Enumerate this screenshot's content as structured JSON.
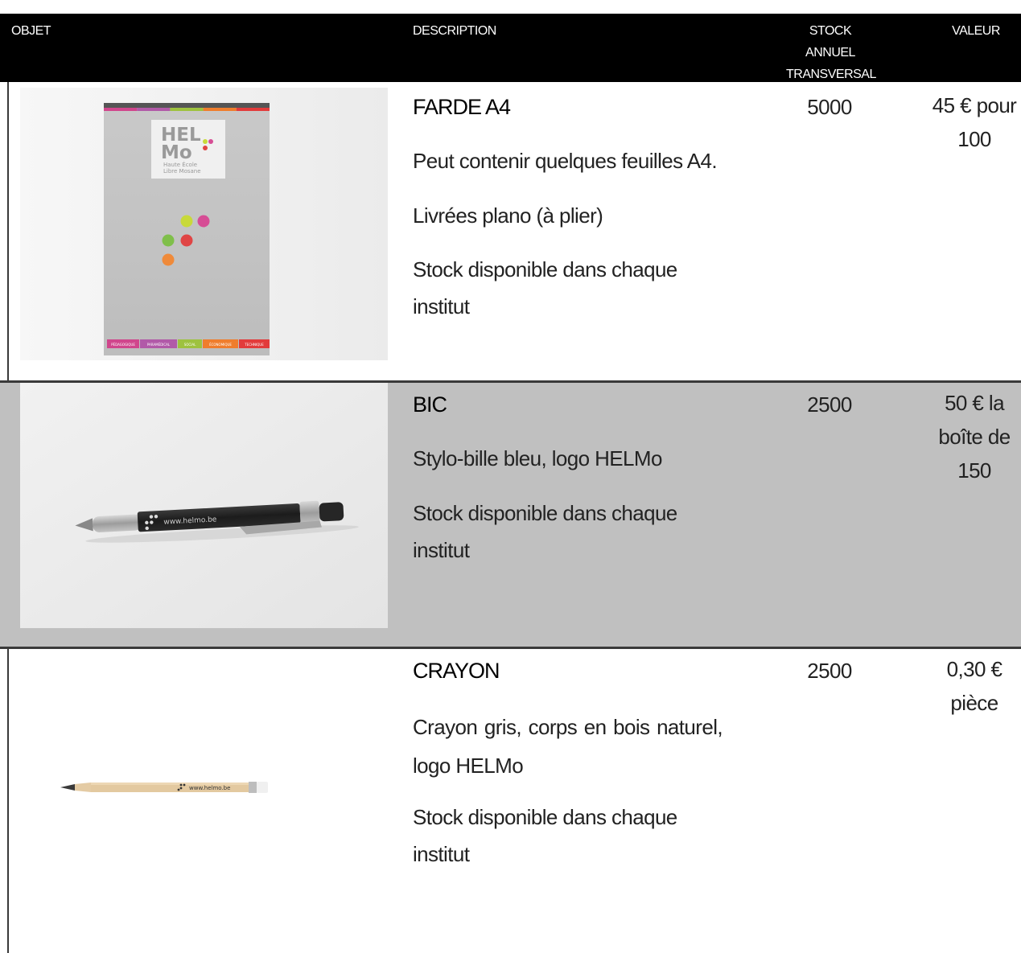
{
  "header": {
    "objet": "OBJET",
    "description": "DESCRIPTION",
    "stock_line1": "STOCK ANNUEL",
    "stock_line2": "TRANSVERSAL",
    "valeur": "VALEUR"
  },
  "rows": [
    {
      "title": "FARDE A4",
      "lines": [
        "Peut contenir quelques feuilles A4.",
        "Livrées plano (à plier)",
        "Stock disponible dans chaque institut"
      ],
      "stock": "5000",
      "value_lines": [
        "45 € pour",
        "100"
      ],
      "photo": {
        "logo_line1": "HEL",
        "logo_line2": "Mo",
        "logo_sub1": "Haute École",
        "logo_sub2": "Libre Mosane",
        "tabs": [
          "PÉDAGOGIQUE",
          "PARAMÉDICAL",
          "SOCIAL",
          "ÉCONOMIQUE",
          "TECHNIQUE"
        ],
        "tab_colors": [
          "#d0468c",
          "#b15aa8",
          "#9ec23f",
          "#ef7d2d",
          "#e23b3b"
        ],
        "dot_colors": [
          "#c8d93a",
          "#d64d95",
          "#7fbf4a",
          "#e04545",
          "#ef8a3a"
        ]
      }
    },
    {
      "title": "BIC",
      "lines": [
        "Stylo-bille bleu, logo HELMo",
        "Stock disponible dans chaque institut"
      ],
      "stock": "2500",
      "value_lines": [
        "50 € la",
        "boîte de",
        "150"
      ],
      "photo": {
        "imprint": "www.helmo.be"
      }
    },
    {
      "title": "CRAYON",
      "lines": [
        "Crayon gris, corps en bois naturel, logo HELMo",
        "Stock disponible dans chaque institut"
      ],
      "stock": "2500",
      "value_lines": [
        "0,30 €",
        "pièce"
      ],
      "photo": {
        "imprint": "www.helmo.be"
      }
    }
  ]
}
